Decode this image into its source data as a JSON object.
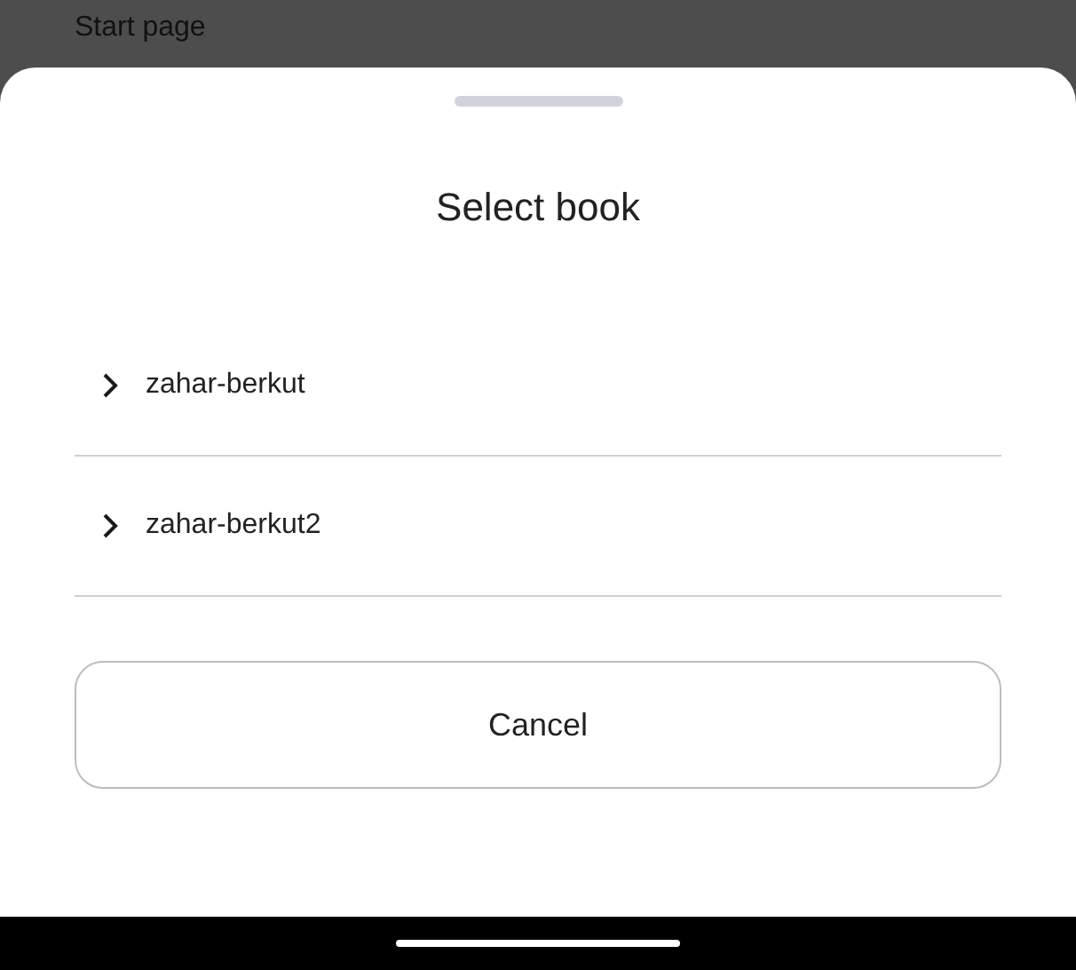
{
  "top_bar": {
    "title": "Start page"
  },
  "sheet": {
    "title": "Select book",
    "items": [
      {
        "label": "zahar-berkut",
        "expanded": false
      },
      {
        "label": "zahar-berkut2",
        "expanded": false
      }
    ],
    "cancel_button": "Cancel"
  }
}
